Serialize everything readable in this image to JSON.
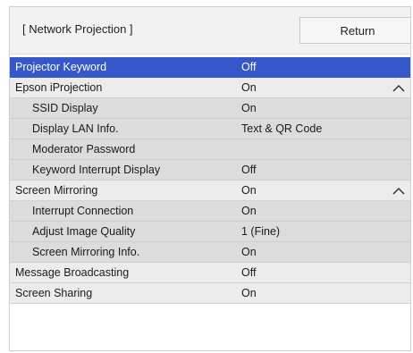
{
  "header": {
    "title": "[ Network Projection ]",
    "return_label": "Return"
  },
  "menu": {
    "rows": [
      {
        "label": "Projector Keyword",
        "value": "Off",
        "level": "top",
        "selected": true
      },
      {
        "label": "Epson iProjection",
        "value": "On",
        "level": "top",
        "expanded": true
      },
      {
        "label": "SSID Display",
        "value": "On",
        "level": "sub"
      },
      {
        "label": "Display LAN Info.",
        "value": "Text & QR Code",
        "level": "sub"
      },
      {
        "label": "Moderator Password",
        "value": "",
        "level": "sub"
      },
      {
        "label": "Keyword Interrupt Display",
        "value": "Off",
        "level": "sub"
      },
      {
        "label": "Screen Mirroring",
        "value": "On",
        "level": "top",
        "expanded": true
      },
      {
        "label": "Interrupt Connection",
        "value": "On",
        "level": "sub"
      },
      {
        "label": "Adjust Image Quality",
        "value": "1 (Fine)",
        "level": "sub"
      },
      {
        "label": "Screen Mirroring Info.",
        "value": "On",
        "level": "sub"
      },
      {
        "label": "Message Broadcasting",
        "value": "Off",
        "level": "top"
      },
      {
        "label": "Screen Sharing",
        "value": "On",
        "level": "top"
      }
    ]
  },
  "colors": {
    "selected_row": "#3557c9",
    "top_row": "#ececec",
    "sub_row": "#dcdcdc",
    "header_bg": "#f2f2f2"
  },
  "icons": {
    "collapse": "chevron-up-icon"
  }
}
